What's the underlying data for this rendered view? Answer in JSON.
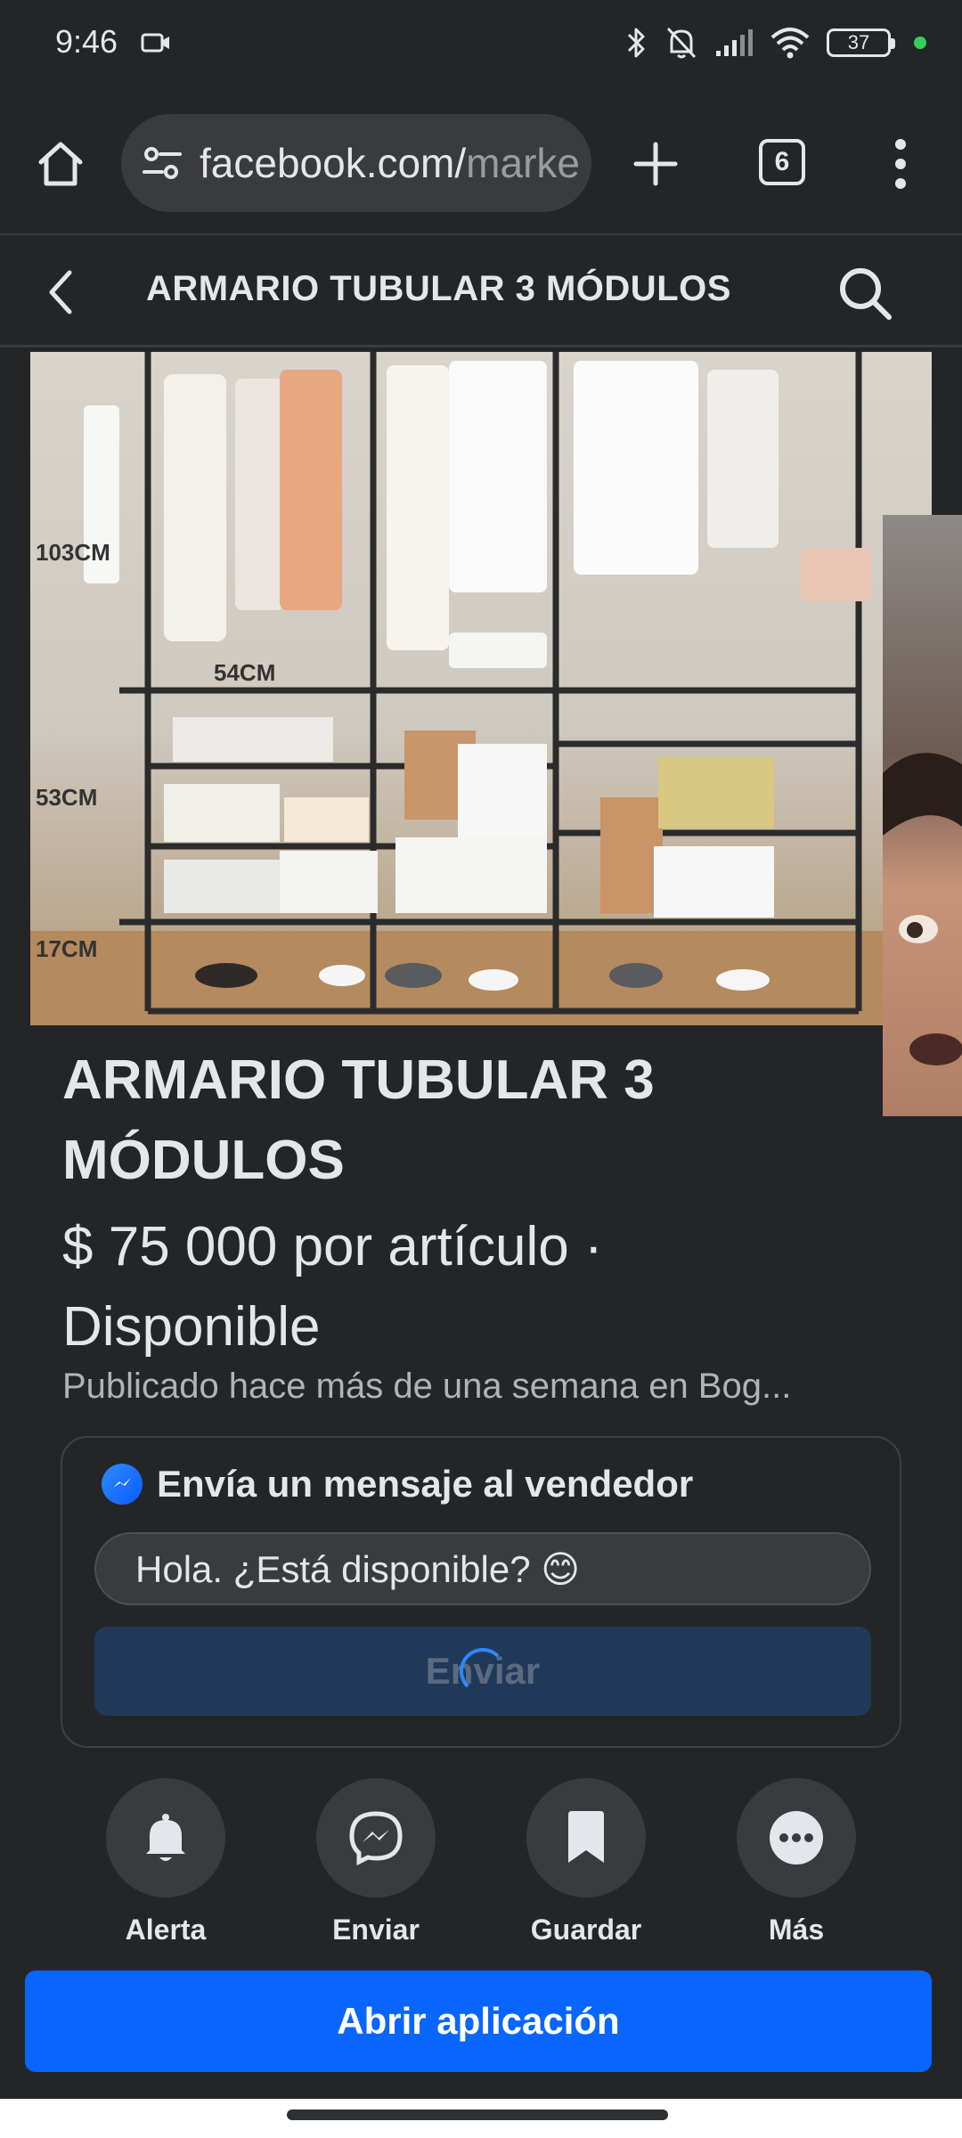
{
  "status_bar": {
    "time": "9:46",
    "battery": "37"
  },
  "browser": {
    "url_host": "facebook.com/",
    "url_path": "marke",
    "tab_count": "6"
  },
  "header": {
    "title": "ARMARIO TUBULAR 3 MÓDULOS"
  },
  "product": {
    "image_labels": [
      "103CM",
      "54CM",
      "53CM",
      "17CM"
    ],
    "title": "ARMARIO TUBULAR 3 MÓDULOS",
    "price_line": "$ 75 000 por artículo · Disponible",
    "meta": "Publicado hace más de una semana en Bog..."
  },
  "message": {
    "heading": "Envía un mensaje al vendedor",
    "input_value": "Hola. ¿Está disponible? 😊",
    "send_label": "Enviar"
  },
  "actions": [
    {
      "label": "Alerta",
      "icon": "bell-icon"
    },
    {
      "label": "Enviar",
      "icon": "messenger-icon"
    },
    {
      "label": "Guardar",
      "icon": "bookmark-icon"
    },
    {
      "label": "Más",
      "icon": "more-icon"
    }
  ],
  "open_app_label": "Abrir aplicación",
  "colors": {
    "background": "#242526",
    "primary_button": "#0866ff",
    "send_button_loading": "#213959"
  }
}
